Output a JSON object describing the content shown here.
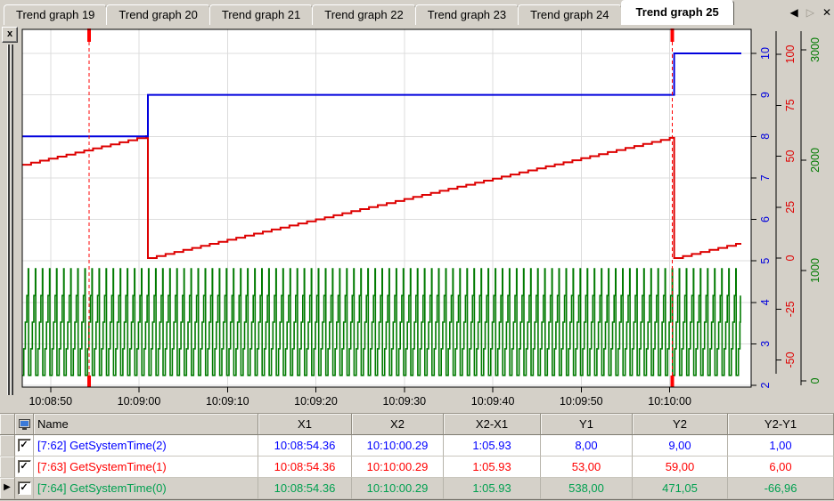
{
  "tabs": {
    "items": [
      {
        "label": "Trend graph 19",
        "active": false
      },
      {
        "label": "Trend graph 20",
        "active": false
      },
      {
        "label": "Trend graph 21",
        "active": false
      },
      {
        "label": "Trend graph 22",
        "active": false
      },
      {
        "label": "Trend graph 23",
        "active": false
      },
      {
        "label": "Trend graph 24",
        "active": false
      },
      {
        "label": "Trend graph 25",
        "active": true
      }
    ],
    "scroll_left_glyph": "◀",
    "scroll_right_glyph": "▷",
    "close_glyph": "✕"
  },
  "chart_panel": {
    "close_button_label": "x"
  },
  "chart_data": {
    "type": "line",
    "grid": true,
    "x_axis": {
      "tick_labels": [
        "10:08:50",
        "10:09:00",
        "10:09:10",
        "10:09:20",
        "10:09:30",
        "10:09:40",
        "10:09:50",
        "10:10:00"
      ],
      "first_tick_offset_s": 3.2,
      "tick_interval_s": 10,
      "span_s": 81.3
    },
    "y_axes": [
      {
        "id": "blue",
        "color": "#0000dd",
        "min": 2,
        "max": 10,
        "ticks": [
          2,
          3,
          4,
          5,
          6,
          7,
          8,
          9,
          10
        ]
      },
      {
        "id": "red",
        "color": "#dd0000",
        "min": -50,
        "max": 100,
        "ticks": [
          -50,
          -25,
          0,
          25,
          50,
          75,
          100
        ]
      },
      {
        "id": "green",
        "color": "#007a00",
        "min": 0,
        "max": 3000,
        "ticks": [
          0,
          1000,
          2000,
          3000
        ]
      }
    ],
    "series": [
      {
        "name": "GetSystemTime(2)",
        "axis": "blue",
        "color": "#0000dd",
        "type": "step",
        "steps": [
          {
            "t": 0,
            "v": 8
          },
          {
            "t": 14.2,
            "v": 9
          },
          {
            "t": 73.7,
            "v": 10
          }
        ],
        "end_t": 81.3
      },
      {
        "name": "GetSystemTime(1)",
        "axis": "red",
        "color": "#dd0000",
        "type": "sawtooth_staircase",
        "start_v": 45.8,
        "slope_per_s": 1,
        "drop_times": [
          14.2,
          73.7
        ],
        "step_s": 1,
        "end_t": 81.3
      },
      {
        "name": "GetSystemTime(0)",
        "axis": "green",
        "color": "#007a00",
        "type": "sawtooth",
        "period_s": 0.8,
        "min_v": 50,
        "max_v": 1015,
        "end_t": 81.2
      }
    ],
    "cursors": [
      {
        "t": 7.56,
        "label": "10:08:54.36",
        "color": "#ff0000"
      },
      {
        "t": 73.49,
        "label": "10:10:00.29",
        "color": "#ff0000"
      }
    ]
  },
  "table": {
    "headers": [
      "Name",
      "X1",
      "X2",
      "X2-X1",
      "Y1",
      "Y2",
      "Y2-Y1"
    ],
    "checkbox_glyph": "✓",
    "current_row_glyph": "▶",
    "rows": [
      {
        "name": "[7:62] GetSystemTime(2)",
        "x1": "10:08:54.36",
        "x2": "10:10:00.29",
        "dx": "1:05.93",
        "y1": "8,00",
        "y2": "9,00",
        "dy": "1,00",
        "color": "#0000ff",
        "checked": true,
        "selected": false
      },
      {
        "name": "[7:63] GetSystemTime(1)",
        "x1": "10:08:54.36",
        "x2": "10:10:00.29",
        "dx": "1:05.93",
        "y1": "53,00",
        "y2": "59,00",
        "dy": "6,00",
        "color": "#ff0000",
        "checked": true,
        "selected": false
      },
      {
        "name": "[7:64] GetSystemTime(0)",
        "x1": "10:08:54.36",
        "x2": "10:10:00.29",
        "dx": "1:05.93",
        "y1": "538,00",
        "y2": "471,05",
        "dy": "-66,96",
        "color": "#00a050",
        "checked": true,
        "selected": true
      }
    ]
  }
}
